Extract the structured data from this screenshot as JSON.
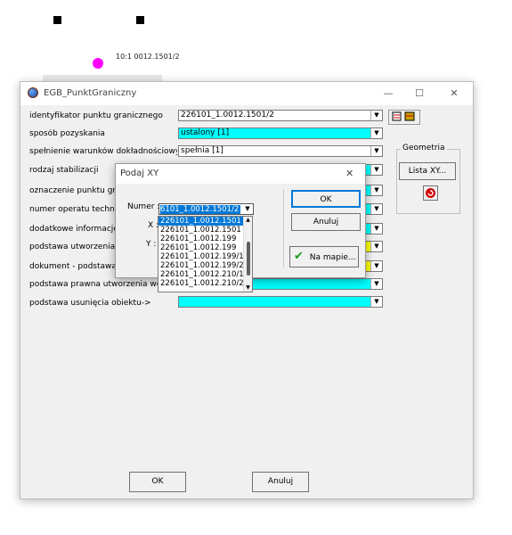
{
  "canvas": {
    "marker_text": "10:1  0012.1501/2"
  },
  "window": {
    "title": "EGB_PunktGraniczny",
    "minimize": "—",
    "maximize": "☐",
    "close": "✕"
  },
  "form": {
    "rows": [
      {
        "label": "identyfikator punktu granicznego",
        "value": "226101_1.0012.1501/2",
        "color": "#ffffff"
      },
      {
        "label": "sposób pozyskania",
        "value": "ustalony [1]",
        "color": "#00ffff"
      },
      {
        "label": "spełnienie warunków dokładnościowych",
        "value": "spełnia [1]",
        "color": "#ffffff"
      },
      {
        "label": "rodzaj stabilizacji",
        "value": "",
        "color": "#00ffff"
      },
      {
        "label": "oznaczenie punktu granicznego",
        "value": "",
        "color": "#00ffff"
      },
      {
        "label": "numer operatu technicznego",
        "value": "",
        "color": "#00ffff"
      },
      {
        "label": "dodatkowe informacje o punkcie",
        "value": "",
        "color": "#00ffff"
      },
      {
        "label": "podstawa utworzenia obiektu",
        "value": "",
        "color": "#ffff00"
      },
      {
        "label": "dokument - podstawa ustalenia",
        "value": "",
        "color": "#ffff00"
      },
      {
        "label": "podstawa prawna utworzenia wersji",
        "value": "",
        "color": "#00ffff"
      },
      {
        "label": "podstawa usunięcia obiektu->",
        "value": "",
        "color": "#00ffff"
      }
    ],
    "geometria": {
      "title": "Geometria",
      "lista_xy": "Lista XY..."
    },
    "ok": "OK",
    "anuluj": "Anuluj"
  },
  "dialog": {
    "title": "Podaj XY",
    "close": "✕",
    "numer_label": "Numer :",
    "numer_value": "6101_1.0012.1501/2",
    "x_label": "X :",
    "y_label": "Y :",
    "ok": "OK",
    "anuluj": "Anuluj",
    "na_mapie": "Na mapie...",
    "list": [
      "226101_1.0012.1501",
      "226101_1.0012.1501",
      "226101_1.0012.199",
      "226101_1.0012.199",
      "226101_1.0012.199/1",
      "226101_1.0012.199/2",
      "226101_1.0012.210/1",
      "226101_1.0012.210/2"
    ]
  },
  "colors": {
    "accent": "#0078d7",
    "cyan": "#00ffff",
    "yellow": "#ffff00",
    "magenta": "#ff00ff"
  }
}
